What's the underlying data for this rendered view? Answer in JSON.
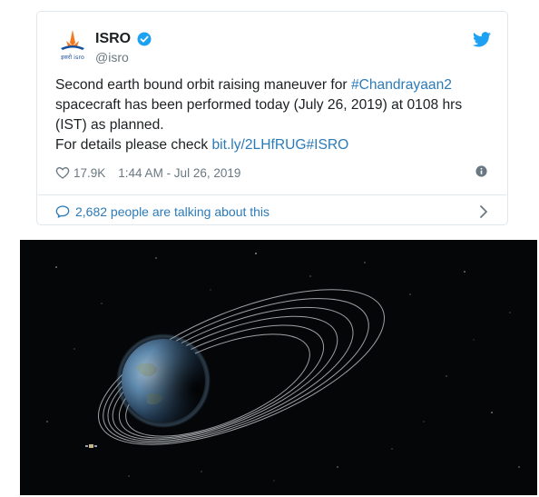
{
  "tweet": {
    "author_name": "ISRO",
    "handle": "@isro",
    "logo_text": "इसरो isro",
    "text_line1_prefix": "Second earth bound orbit raising maneuver for ",
    "hashtag": "#Chandrayaan2",
    "text_line2": "spacecraft has been performed today (July 26, 2019) at 0108 hrs",
    "text_line3": "(IST) as planned.",
    "text_line4_prefix": "For details please check ",
    "link": "bit.ly/2LHfRUG#ISRO",
    "like_count": "17.9K",
    "timestamp": "1:44 AM - Jul 26, 2019",
    "talking": "2,682 people are talking about this"
  },
  "colors": {
    "link": "#2b7bb9",
    "muted": "#697882",
    "twitter_blue": "#1da1f2",
    "isro_orange": "#f47920",
    "isro_blue": "#1b4f9c"
  },
  "icons": [
    "isro-logo-icon",
    "verified-badge-icon",
    "twitter-bird-icon",
    "heart-icon",
    "info-icon",
    "speech-bubble-icon",
    "chevron-right-icon"
  ]
}
